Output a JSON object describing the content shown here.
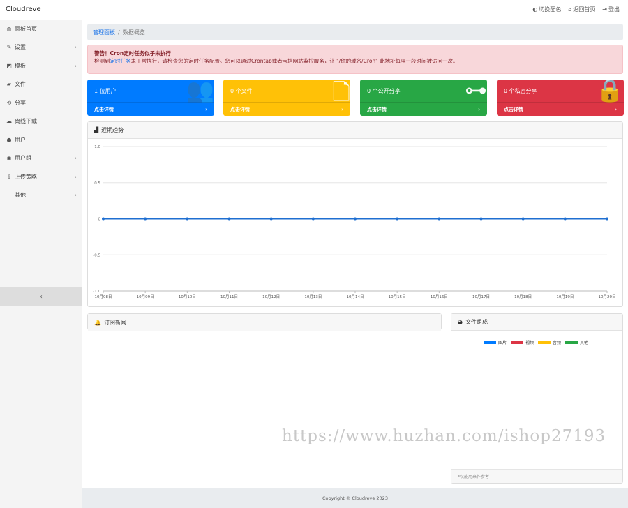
{
  "app": {
    "brand": "Cloudreve"
  },
  "top_actions": [
    {
      "icon": "toggle-icon",
      "glyph": "◐",
      "label": "切换配色"
    },
    {
      "icon": "home-icon",
      "glyph": "⌂",
      "label": "返回首页"
    },
    {
      "icon": "logout-icon",
      "glyph": "⇥",
      "label": "登出"
    }
  ],
  "sidebar": {
    "items": [
      {
        "glyph": "◍",
        "label": "面板首页",
        "chevron": ""
      },
      {
        "glyph": "✎",
        "label": "设置",
        "chevron": "›"
      },
      {
        "glyph": "◩",
        "label": "模板",
        "chevron": "›"
      },
      {
        "glyph": "▰",
        "label": "文件",
        "chevron": ""
      },
      {
        "glyph": "⟲",
        "label": "分享",
        "chevron": ""
      },
      {
        "glyph": "☁",
        "label": "离线下载",
        "chevron": ""
      },
      {
        "glyph": "●",
        "label": "用户",
        "chevron": ""
      },
      {
        "glyph": "◉",
        "label": "用户组",
        "chevron": "›"
      },
      {
        "glyph": "⇪",
        "label": "上传策略",
        "chevron": "›"
      },
      {
        "glyph": "⋯",
        "label": "其他",
        "chevron": "›"
      }
    ],
    "collapse_glyph": "‹"
  },
  "breadcrumb": {
    "link": "管理面板",
    "sep": "/",
    "current": "数据概览"
  },
  "alert": {
    "title": "警告！Cron定时任务似乎未执行",
    "line_pre": "检测到",
    "line_link": "定时任务",
    "line_post": "未正常执行，请检查您的定时任务配置。您可以通过Crontab或者宝塔网站监控服务，让 \"/你的域名/Cron\" 此地址每隔一段时间被访问一次。"
  },
  "cards": [
    {
      "count": "1 位用户",
      "foot": "点击详情",
      "arrow": "›",
      "icon": "users-icon",
      "glyph": "👥",
      "color": "#007bff"
    },
    {
      "count": "0 个文件",
      "foot": "点击详情",
      "arrow": "›",
      "icon": "file-icon",
      "glyph": "🗋",
      "color": "#ffc107"
    },
    {
      "count": "0 个公开分享",
      "foot": "点击详情",
      "arrow": "›",
      "icon": "share-icon",
      "glyph": "⊶",
      "color": "#28a745"
    },
    {
      "count": "0 个私密分享",
      "foot": "点击详情",
      "arrow": "›",
      "icon": "lock-icon",
      "glyph": "🔒",
      "color": "#dc3545"
    }
  ],
  "trend_panel": {
    "title": "近期趋势",
    "glyph": "▟"
  },
  "subscribe_panel": {
    "title": "订阅新闻",
    "glyph": "🔔"
  },
  "files_panel": {
    "title": "文件组成",
    "glyph": "◕",
    "legend": [
      {
        "name": "图片",
        "color": "#007bff"
      },
      {
        "name": "视频",
        "color": "#dc3545"
      },
      {
        "name": "音频",
        "color": "#ffc107"
      },
      {
        "name": "其他",
        "color": "#28a745"
      }
    ],
    "footer": "*仅能用来作参考"
  },
  "chart_data": {
    "type": "line",
    "categories": [
      "10月08日",
      "10月09日",
      "10月10日",
      "10月11日",
      "10月12日",
      "10月13日",
      "10月14日",
      "10月15日",
      "10月16日",
      "10月17日",
      "10月18日",
      "10月19日",
      "10月20日"
    ],
    "series": [
      {
        "values": [
          0,
          0,
          0,
          0,
          0,
          0,
          0,
          0,
          0,
          0,
          0,
          0,
          0
        ],
        "color": "#1f6fd1"
      }
    ],
    "yticks": [
      "1.0",
      "0.5",
      "0",
      "-0.5",
      "-1.0"
    ],
    "ylim": [
      -1,
      1
    ],
    "grid": true
  },
  "footer": {
    "text": "Copyright © Cloudreve 2023"
  },
  "watermark": {
    "text": "https://www.huzhan.com/ishop27193"
  }
}
